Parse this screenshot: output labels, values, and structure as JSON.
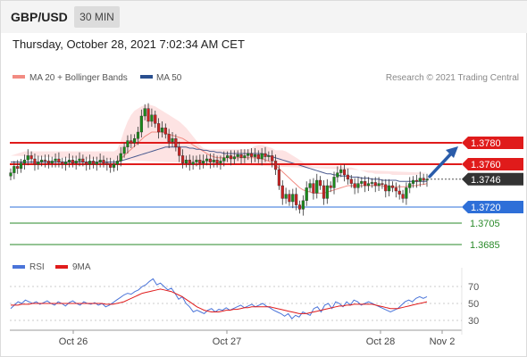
{
  "header": {
    "pair": "GBP/USD",
    "timeframe": "30 MIN",
    "datetime": "Thursday, October 28, 2021 7:02:34 AM CET"
  },
  "legend": {
    "main": [
      {
        "name": "MA 20 + Bollinger Bands",
        "color": "#f28b82"
      },
      {
        "name": "MA 50",
        "color": "#2a4f8f"
      }
    ],
    "rsi": [
      {
        "name": "RSI",
        "color": "#4a74d9"
      },
      {
        "name": "9MA",
        "color": "#e01b1b"
      }
    ]
  },
  "credit": "Research © 2021 Trading Central",
  "colors": {
    "resistance": "#e01b1b",
    "current": "#333333",
    "pivot": "#2e6fd8",
    "support": "#2a8a2a",
    "arrow": "#2a5caa",
    "up": "#1a8a1a",
    "down": "#cc2222",
    "band": "#fde3e3"
  },
  "chart_data": [
    {
      "type": "candlestick",
      "title": "GBP/USD 30 MIN",
      "ylim": [
        1.367,
        1.3805
      ],
      "x_ticks": [
        "Oct 26",
        "Oct 27",
        "Oct 28",
        "Nov 2"
      ],
      "levels": [
        {
          "label": "1.3780",
          "value": 1.378,
          "kind": "resistance"
        },
        {
          "label": "1.3760",
          "value": 1.376,
          "kind": "resistance"
        },
        {
          "label": "1.3746",
          "value": 1.3746,
          "kind": "current"
        },
        {
          "label": "1.3720",
          "value": 1.372,
          "kind": "pivot"
        },
        {
          "label": "1.3705",
          "value": 1.3705,
          "kind": "support"
        },
        {
          "label": "1.3685",
          "value": 1.3685,
          "kind": "support"
        }
      ],
      "close": [
        1.3752,
        1.3758,
        1.3756,
        1.3761,
        1.3764,
        1.3768,
        1.3765,
        1.376,
        1.3762,
        1.3764,
        1.3763,
        1.3761,
        1.3763,
        1.3765,
        1.3762,
        1.376,
        1.3762,
        1.3764,
        1.3761,
        1.3763,
        1.3765,
        1.3762,
        1.376,
        1.3763,
        1.376,
        1.3762,
        1.3764,
        1.3761,
        1.376,
        1.3757,
        1.376,
        1.3763,
        1.377,
        1.3776,
        1.3782,
        1.378,
        1.3784,
        1.379,
        1.3805,
        1.3812,
        1.38,
        1.3806,
        1.3798,
        1.379,
        1.3794,
        1.3788,
        1.3781,
        1.3784,
        1.3776,
        1.3768,
        1.3761,
        1.3764,
        1.376,
        1.3762,
        1.3764,
        1.3761,
        1.3763,
        1.3765,
        1.3762,
        1.3764,
        1.3761,
        1.3763,
        1.3766,
        1.3768,
        1.3765,
        1.3767,
        1.3769,
        1.3766,
        1.3768,
        1.377,
        1.3767,
        1.3769,
        1.3765,
        1.377,
        1.3767,
        1.3768,
        1.3763,
        1.3755,
        1.374,
        1.3728,
        1.3732,
        1.3725,
        1.3732,
        1.3722,
        1.3718,
        1.3726,
        1.3738,
        1.3742,
        1.3733,
        1.3745,
        1.374,
        1.3728,
        1.374,
        1.3738,
        1.3748,
        1.3752,
        1.3755,
        1.375,
        1.3746,
        1.3742,
        1.3738,
        1.3742,
        1.3744,
        1.374,
        1.3742,
        1.3743,
        1.374,
        1.3742,
        1.3741,
        1.3735,
        1.374,
        1.3738,
        1.3735,
        1.3732,
        1.3728,
        1.3738,
        1.3742,
        1.3745,
        1.3744,
        1.3747,
        1.3745,
        1.3746
      ],
      "ma20": [
        1.3762,
        1.3762,
        1.3762,
        1.3762,
        1.3762,
        1.3762,
        1.3762,
        1.3762,
        1.3762,
        1.3762,
        1.3762,
        1.3762,
        1.3762,
        1.3762,
        1.3762,
        1.3762,
        1.3762,
        1.3762,
        1.3762,
        1.3762,
        1.3762,
        1.3762,
        1.3762,
        1.3762,
        1.3762,
        1.3762,
        1.3762,
        1.3762,
        1.3762,
        1.3762,
        1.3762,
        1.3762,
        1.3765,
        1.3768,
        1.3771,
        1.3774,
        1.3777,
        1.378,
        1.3783,
        1.3786,
        1.3788,
        1.379,
        1.379,
        1.379,
        1.379,
        1.3789,
        1.3788,
        1.3787,
        1.3786,
        1.3785,
        1.3784,
        1.3782,
        1.378,
        1.3778,
        1.3776,
        1.3774,
        1.3772,
        1.377,
        1.3768,
        1.3767,
        1.3766,
        1.3766,
        1.3766,
        1.3766,
        1.3766,
        1.3766,
        1.3766,
        1.3766,
        1.3766,
        1.3766,
        1.3766,
        1.3766,
        1.3766,
        1.3765,
        1.3764,
        1.3763,
        1.3761,
        1.3759,
        1.3756,
        1.3753,
        1.375,
        1.3747,
        1.3744,
        1.3741,
        1.3738,
        1.3736,
        1.3735,
        1.3734,
        1.3733,
        1.3733,
        1.3733,
        1.3733,
        1.3734,
        1.3735,
        1.3736,
        1.3737,
        1.3738,
        1.3739,
        1.374,
        1.374,
        1.374,
        1.374,
        1.374,
        1.374,
        1.374,
        1.374,
        1.374,
        1.374,
        1.374,
        1.3739,
        1.3739,
        1.3739,
        1.3739,
        1.3739,
        1.3739,
        1.3739,
        1.374,
        1.374,
        1.374,
        1.3741,
        1.3741,
        1.3742
      ],
      "ma50": [
        1.3762,
        1.3762,
        1.3762,
        1.3762,
        1.3762,
        1.3762,
        1.3762,
        1.3762,
        1.3762,
        1.3762,
        1.3762,
        1.3762,
        1.3762,
        1.3762,
        1.3762,
        1.3762,
        1.3762,
        1.3762,
        1.3762,
        1.3762,
        1.3762,
        1.3762,
        1.3762,
        1.3762,
        1.3762,
        1.3762,
        1.3762,
        1.3762,
        1.3762,
        1.3762,
        1.3762,
        1.3762,
        1.3763,
        1.3764,
        1.3765,
        1.3766,
        1.3767,
        1.3768,
        1.3769,
        1.377,
        1.3771,
        1.3772,
        1.3773,
        1.3774,
        1.3775,
        1.3776,
        1.3776,
        1.3776,
        1.3776,
        1.3776,
        1.3776,
        1.3776,
        1.3775,
        1.3775,
        1.3774,
        1.3774,
        1.3773,
        1.3773,
        1.3772,
        1.3772,
        1.3771,
        1.3771,
        1.377,
        1.377,
        1.377,
        1.377,
        1.377,
        1.377,
        1.377,
        1.377,
        1.377,
        1.377,
        1.377,
        1.377,
        1.3769,
        1.3768,
        1.3767,
        1.3766,
        1.3765,
        1.3764,
        1.3763,
        1.3762,
        1.3761,
        1.376,
        1.3759,
        1.3758,
        1.3757,
        1.3756,
        1.3755,
        1.3754,
        1.3753,
        1.3752,
        1.3751,
        1.3751,
        1.375,
        1.375,
        1.3749,
        1.3749,
        1.3749,
        1.3748,
        1.3748,
        1.3748,
        1.3747,
        1.3747,
        1.3747,
        1.3746,
        1.3746,
        1.3746,
        1.3745,
        1.3745,
        1.3745,
        1.3745,
        1.3745,
        1.3744,
        1.3744,
        1.3744,
        1.3744,
        1.3744,
        1.3744,
        1.3744,
        1.3744,
        1.3744
      ],
      "bb_upper": [
        1.3768,
        1.3769,
        1.377,
        1.3771,
        1.3772,
        1.3772,
        1.3772,
        1.3772,
        1.3772,
        1.3772,
        1.3772,
        1.3772,
        1.3772,
        1.3772,
        1.3772,
        1.3772,
        1.3772,
        1.3772,
        1.3772,
        1.3772,
        1.3772,
        1.3772,
        1.3772,
        1.3772,
        1.3772,
        1.3772,
        1.3772,
        1.3772,
        1.3772,
        1.3772,
        1.3772,
        1.3774,
        1.3782,
        1.3792,
        1.38,
        1.3806,
        1.381,
        1.3812,
        1.3814,
        1.3815,
        1.3816,
        1.3815,
        1.3814,
        1.3812,
        1.381,
        1.3808,
        1.3806,
        1.3804,
        1.3802,
        1.38,
        1.3797,
        1.3794,
        1.379,
        1.3786,
        1.3782,
        1.3778,
        1.3775,
        1.3774,
        1.3774,
        1.3774,
        1.3774,
        1.3774,
        1.3774,
        1.3774,
        1.3774,
        1.3774,
        1.3774,
        1.3774,
        1.3774,
        1.3774,
        1.3775,
        1.3777,
        1.3778,
        1.3778,
        1.3777,
        1.3776,
        1.3775,
        1.3773,
        1.3773,
        1.3773,
        1.3772,
        1.377,
        1.3768,
        1.3766,
        1.3764,
        1.3762,
        1.376,
        1.3759,
        1.3758,
        1.3758,
        1.3758,
        1.3758,
        1.3758,
        1.3758,
        1.3758,
        1.3758,
        1.3758,
        1.3757,
        1.3757,
        1.3757,
        1.3756,
        1.3755,
        1.3754,
        1.3753,
        1.3752,
        1.3752,
        1.3751,
        1.3751,
        1.3751,
        1.3751,
        1.3751,
        1.375,
        1.375,
        1.375,
        1.375,
        1.375,
        1.375,
        1.375,
        1.375,
        1.3751,
        1.3751,
        1.3752
      ],
      "bb_lower": [
        1.3756,
        1.3755,
        1.3754,
        1.3754,
        1.3754,
        1.3754,
        1.3754,
        1.3754,
        1.3754,
        1.3754,
        1.3754,
        1.3754,
        1.3754,
        1.3754,
        1.3754,
        1.3754,
        1.3754,
        1.3754,
        1.3754,
        1.3754,
        1.3754,
        1.3754,
        1.3754,
        1.3754,
        1.3754,
        1.3754,
        1.3754,
        1.3754,
        1.3754,
        1.3753,
        1.3752,
        1.3748,
        1.3744,
        1.374,
        1.3738,
        1.3738,
        1.374,
        1.3744,
        1.3748,
        1.3752,
        1.3756,
        1.376,
        1.3762,
        1.3764,
        1.3764,
        1.3763,
        1.3762,
        1.376,
        1.3758,
        1.3756,
        1.3755,
        1.3755,
        1.3755,
        1.3756,
        1.3757,
        1.3758,
        1.3758,
        1.3758,
        1.3758,
        1.3758,
        1.3758,
        1.3758,
        1.3758,
        1.3758,
        1.3758,
        1.3758,
        1.3758,
        1.3758,
        1.3758,
        1.3757,
        1.3755,
        1.3752,
        1.3748,
        1.3744,
        1.3738,
        1.3732,
        1.3726,
        1.372,
        1.3716,
        1.3714,
        1.3713,
        1.3713,
        1.3714,
        1.3715,
        1.3716,
        1.3717,
        1.3718,
        1.3719,
        1.372,
        1.3721,
        1.3722,
        1.3723,
        1.3724,
        1.3725,
        1.3726,
        1.3726,
        1.3727,
        1.3727,
        1.3727,
        1.3727,
        1.3727,
        1.3727,
        1.3727,
        1.3727,
        1.3727,
        1.3727,
        1.3727,
        1.3727,
        1.3727,
        1.3727,
        1.3727,
        1.3728,
        1.3728,
        1.3728,
        1.3728,
        1.3729,
        1.3729,
        1.3729,
        1.373,
        1.373,
        1.3731
      ]
    },
    {
      "type": "line",
      "title": "RSI",
      "ylim": [
        20,
        80
      ],
      "y_ticks": [
        "70",
        "50",
        "30"
      ],
      "series": [
        {
          "name": "RSI",
          "values": [
            44,
            48,
            52,
            50,
            54,
            52,
            50,
            52,
            49,
            51,
            53,
            50,
            48,
            52,
            50,
            47,
            51,
            53,
            50,
            48,
            52,
            50,
            49,
            51,
            48,
            50,
            46,
            48,
            51,
            54,
            57,
            60,
            62,
            61,
            64,
            66,
            70,
            72,
            76,
            79,
            72,
            74,
            70,
            66,
            68,
            62,
            55,
            58,
            50,
            46,
            40,
            42,
            40,
            38,
            42,
            44,
            40,
            43,
            42,
            45,
            42,
            44,
            46,
            48,
            45,
            47,
            49,
            46,
            48,
            50,
            47,
            45,
            42,
            40,
            38,
            35,
            38,
            32,
            36,
            34,
            40,
            38,
            36,
            44,
            46,
            40,
            48,
            50,
            44,
            52,
            50,
            46,
            52,
            48,
            54,
            52,
            48,
            50,
            52,
            50,
            48,
            46,
            44,
            42,
            40,
            42,
            44,
            48,
            52,
            54,
            52,
            56,
            58,
            56,
            58
          ]
        },
        {
          "name": "9MA",
          "values": [
            48,
            48,
            48,
            49,
            49,
            49,
            50,
            50,
            50,
            50,
            50,
            50,
            50,
            50,
            50,
            50,
            50,
            50,
            50,
            50,
            50,
            50,
            50,
            50,
            50,
            50,
            49,
            49,
            49,
            50,
            51,
            52,
            54,
            56,
            58,
            60,
            62,
            63,
            64,
            65,
            66,
            67,
            66,
            65,
            64,
            62,
            60,
            58,
            55,
            52,
            49,
            46,
            44,
            42,
            41,
            40,
            40,
            40,
            41,
            42,
            42,
            43,
            43,
            44,
            45,
            45,
            46,
            46,
            46,
            46,
            46,
            46,
            45,
            44,
            43,
            42,
            41,
            40,
            39,
            38,
            38,
            38,
            39,
            40,
            41,
            42,
            43,
            44,
            45,
            46,
            47,
            47,
            48,
            48,
            49,
            49,
            49,
            49,
            49,
            49,
            48,
            47,
            46,
            45,
            44,
            44,
            44,
            45,
            46,
            47,
            48,
            49,
            50,
            51,
            52
          ]
        }
      ]
    }
  ]
}
